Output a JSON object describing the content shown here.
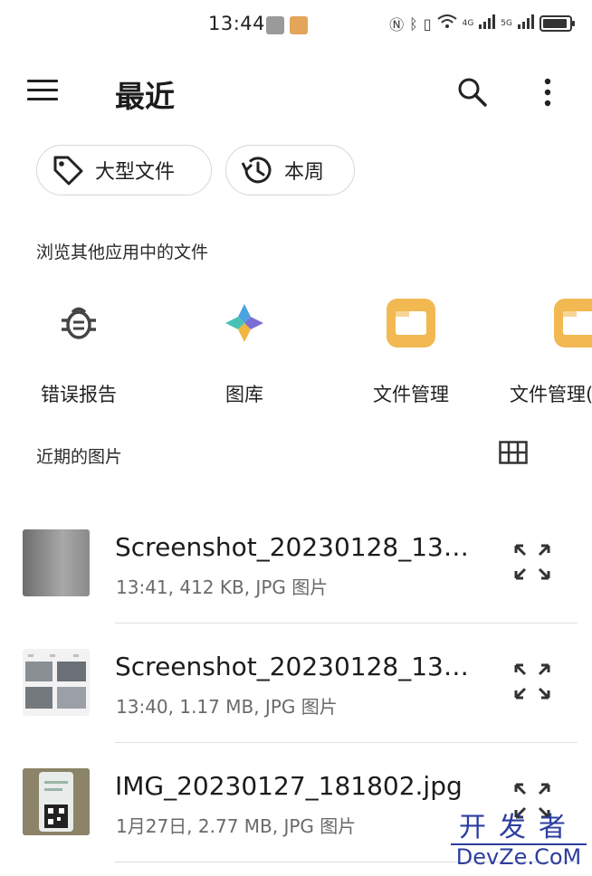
{
  "status_bar": {
    "time": "13:44",
    "net1": "4G",
    "net2": "5G"
  },
  "app_bar": {
    "title": "最近",
    "menu_icon": "menu-icon",
    "search_icon": "search-icon",
    "more_icon": "more-vert-icon"
  },
  "chips": [
    {
      "label": "大型文件",
      "icon": "tag-icon"
    },
    {
      "label": "本周",
      "icon": "history-icon"
    }
  ],
  "browse_section": {
    "title": "浏览其他应用中的文件"
  },
  "apps": [
    {
      "label": "错误报告",
      "icon": "bug-icon"
    },
    {
      "label": "图库",
      "icon": "gallery-icon"
    },
    {
      "label": "文件管理",
      "icon": "file-manager-icon"
    },
    {
      "label": "文件管理(",
      "icon": "file-manager-icon"
    }
  ],
  "recent_section": {
    "title": "近期的图片",
    "view_toggle_icon": "grid-view-icon"
  },
  "files": [
    {
      "name": "Screenshot_20230128_13…",
      "meta": "13:41, 412 KB, JPG 图片"
    },
    {
      "name": "Screenshot_20230128_13…",
      "meta": "13:40, 1.17 MB, JPG 图片"
    },
    {
      "name": "IMG_20230127_181802.jpg",
      "meta": "1月27日, 2.77 MB, JPG 图片"
    }
  ],
  "watermark": {
    "line1": "开发者",
    "line2": "DevZe.CoM"
  },
  "colors": {
    "accent_folder": "#f2b851",
    "watermark": "#2c3ea0"
  }
}
